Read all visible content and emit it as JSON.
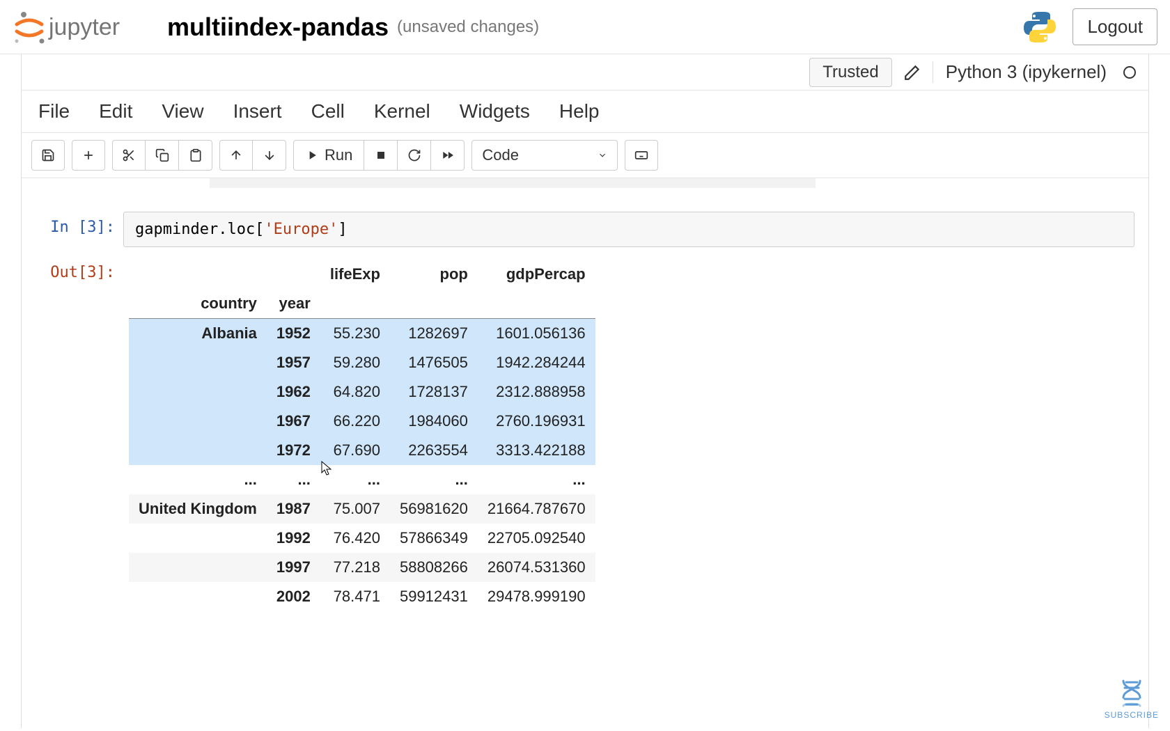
{
  "header": {
    "logo_text": "jupyter",
    "title": "multiindex-pandas",
    "status": "(unsaved changes)",
    "logout": "Logout"
  },
  "trustbar": {
    "trusted": "Trusted",
    "kernel": "Python 3 (ipykernel)"
  },
  "menu": [
    "File",
    "Edit",
    "View",
    "Insert",
    "Cell",
    "Kernel",
    "Widgets",
    "Help"
  ],
  "toolbar": {
    "run_label": "Run",
    "celltype": "Code"
  },
  "cell": {
    "in_prompt": "In [3]:",
    "out_prompt": "Out[3]:",
    "code_pre": "gapminder.loc[",
    "code_str": "'Europe'",
    "code_post": "]"
  },
  "table": {
    "value_cols": [
      "lifeExp",
      "pop",
      "gdpPercap"
    ],
    "index_cols": [
      "country",
      "year"
    ],
    "row0": {
      "country": "Albania",
      "year": "1952",
      "lifeExp": "55.230",
      "pop": "1282697",
      "gdp": "1601.056136"
    },
    "row1": {
      "country": "",
      "year": "1957",
      "lifeExp": "59.280",
      "pop": "1476505",
      "gdp": "1942.284244"
    },
    "row2": {
      "country": "",
      "year": "1962",
      "lifeExp": "64.820",
      "pop": "1728137",
      "gdp": "2312.888958"
    },
    "row3": {
      "country": "",
      "year": "1967",
      "lifeExp": "66.220",
      "pop": "1984060",
      "gdp": "2760.196931"
    },
    "row4": {
      "country": "",
      "year": "1972",
      "lifeExp": "67.690",
      "pop": "2263554",
      "gdp": "3313.422188"
    },
    "row5": {
      "country": "...",
      "year": "...",
      "lifeExp": "...",
      "pop": "...",
      "gdp": "..."
    },
    "row6": {
      "country": "United Kingdom",
      "year": "1987",
      "lifeExp": "75.007",
      "pop": "56981620",
      "gdp": "21664.787670"
    },
    "row7": {
      "country": "",
      "year": "1992",
      "lifeExp": "76.420",
      "pop": "57866349",
      "gdp": "22705.092540"
    },
    "row8": {
      "country": "",
      "year": "1997",
      "lifeExp": "77.218",
      "pop": "58808266",
      "gdp": "26074.531360"
    },
    "row9": {
      "country": "",
      "year": "2002",
      "lifeExp": "78.471",
      "pop": "59912431",
      "gdp": "29478.999190"
    }
  },
  "badge": {
    "text": "SUBSCRIBE"
  }
}
